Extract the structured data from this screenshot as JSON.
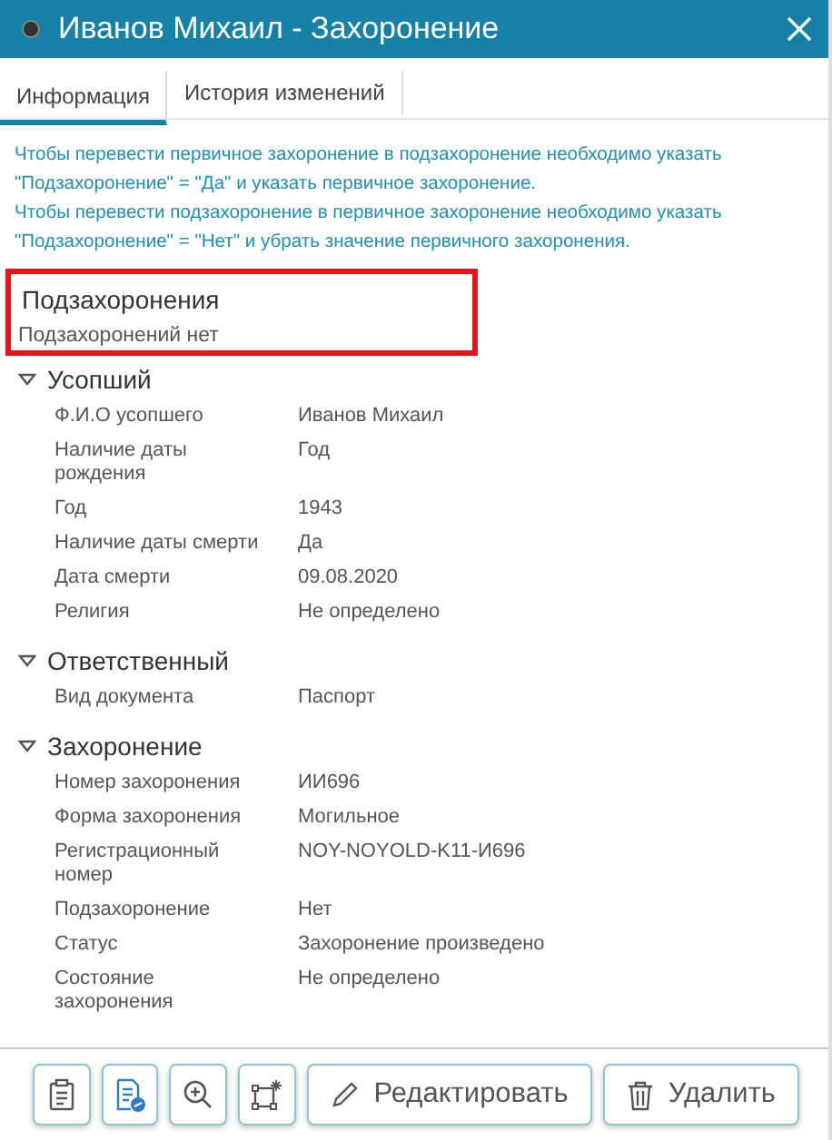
{
  "window": {
    "title": "Иванов Михаил - Захоронение"
  },
  "tabs": [
    {
      "label": "Информация",
      "selected": true
    },
    {
      "label": "История изменений",
      "selected": false
    }
  ],
  "notice": [
    "Чтобы перевести первичное захоронение в подзахоронение необходимо указать \"Подзахоронение\" = \"Да\" и указать первичное захоронение.",
    "Чтобы перевести подзахоронение в первичное захоронение необходимо указать \"Подзахоронение\" = \"Нет\" и убрать значение первичного захоронения."
  ],
  "subburials": {
    "title": "Подзахоронения",
    "text": "Подзахоронений нет"
  },
  "sections": [
    {
      "title": "Усопший",
      "expanded": true,
      "fields": [
        {
          "label": "Ф.И.О усопшего",
          "value": "Иванов Михаил"
        },
        {
          "label": "Наличие даты рождения",
          "value": "Год"
        },
        {
          "label": "Год",
          "value": "1943"
        },
        {
          "label": "Наличие даты смерти",
          "value": "Да"
        },
        {
          "label": "Дата смерти",
          "value": "09.08.2020"
        },
        {
          "label": "Религия",
          "value": "Не определено"
        }
      ]
    },
    {
      "title": "Ответственный",
      "expanded": true,
      "fields": [
        {
          "label": "Вид документа",
          "value": "Паспорт"
        }
      ]
    },
    {
      "title": "Захоронение",
      "expanded": true,
      "fields": [
        {
          "label": "Номер захоронения",
          "value": "ИИ696"
        },
        {
          "label": "Форма захоронения",
          "value": "Могильное"
        },
        {
          "label": "Регистрационный номер",
          "value": "NOY-NOYOLD-K11-И696"
        },
        {
          "label": "Подзахоронение",
          "value": "Нет"
        },
        {
          "label": "Статус",
          "value": "Захоронение произведено"
        },
        {
          "label": "Состояние захоронения",
          "value": "Не определено"
        }
      ]
    }
  ],
  "toolbar": [
    {
      "kind": "clipboard"
    },
    {
      "kind": "document"
    },
    {
      "kind": "zoom"
    },
    {
      "kind": "frame"
    },
    {
      "kind": "edit",
      "label": "Редактировать"
    },
    {
      "kind": "delete",
      "label": "Удалить"
    }
  ]
}
